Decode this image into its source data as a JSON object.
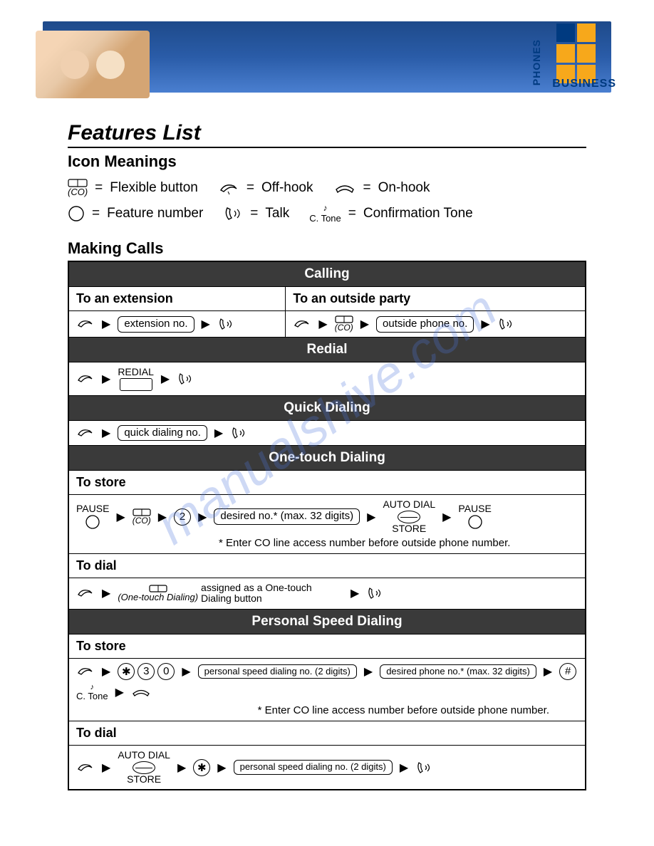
{
  "logo": {
    "vert": "PHONES",
    "horiz": "BUSINESS"
  },
  "title": "Features List",
  "icon_meanings_header": "Icon Meanings",
  "icons": {
    "flexible": "Flexible button",
    "offhook": "Off-hook",
    "onhook": "On-hook",
    "feature_number": "Feature number",
    "talk": "Talk",
    "ctone_label": "C. Tone",
    "ctone": "Confirmation Tone",
    "co_label": "(CO)"
  },
  "making_calls": "Making Calls",
  "sections": {
    "calling": "Calling",
    "to_extension": "To an extension",
    "extension_no": "extension no.",
    "to_outside": "To an outside party",
    "outside_phone_no": "outside phone no.",
    "redial": "Redial",
    "redial_btn": "REDIAL",
    "quick_dialing": "Quick Dialing",
    "quick_dialing_no": "quick dialing no.",
    "one_touch": "One-touch Dialing",
    "to_store": "To store",
    "pause": "PAUSE",
    "desired_no": "desired no.* (max. 32 digits)",
    "auto_dial": "AUTO DIAL",
    "store": "STORE",
    "note_co": "* Enter CO line access number before outside phone number.",
    "to_dial": "To dial",
    "one_touch_italic": "(One-touch Dialing)",
    "assigned_text": "assigned as a One-touch Dialing button",
    "psd": "Personal Speed Dialing",
    "psd_no": "personal speed dialing no. (2 digits)",
    "desired_phone": "desired phone no.* (max. 32 digits)",
    "ctone_short": "C. Tone"
  },
  "watermark": "manualshive.com"
}
